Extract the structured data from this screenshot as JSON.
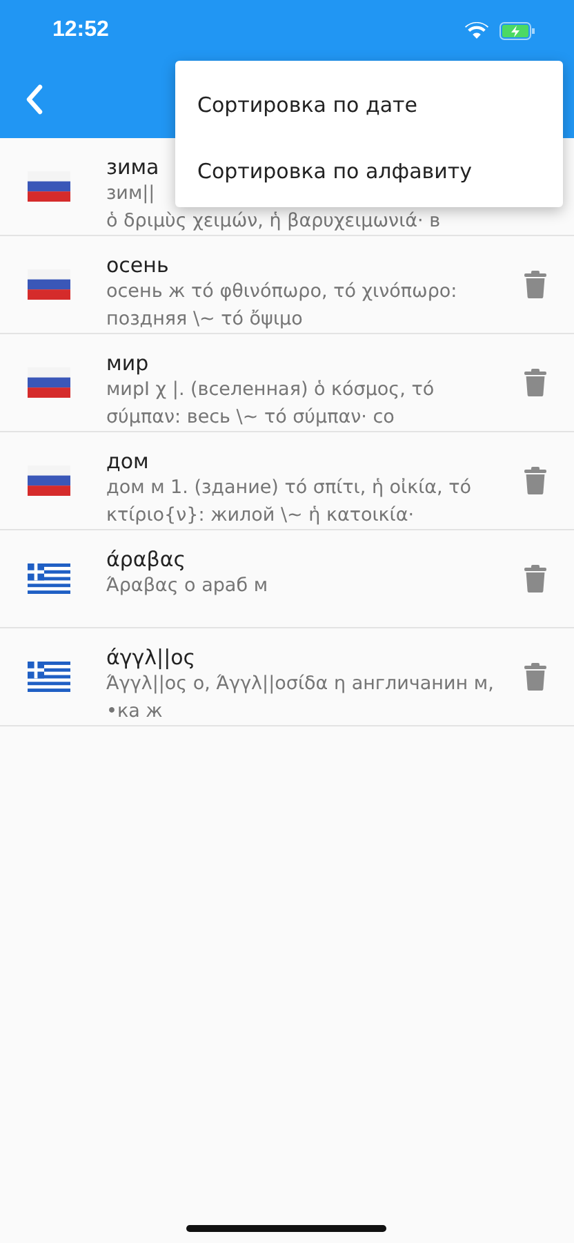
{
  "status_bar": {
    "time": "12:52"
  },
  "menu": {
    "items": [
      {
        "label": "Сортировка по дате"
      },
      {
        "label": "Сортировка по алфавиту"
      }
    ]
  },
  "entries": [
    {
      "kind": "ru",
      "word": "зима",
      "description": "зим||\nὁ δριμὺς χειμών, ἡ βαρυχειμωνιά· в",
      "has_delete": false
    },
    {
      "kind": "ru",
      "word": "осень",
      "description": " осень ж τό φθινόπωρο, τό χινόπωρο: поздняя \\~ τό ὄψιμο",
      "has_delete": true
    },
    {
      "kind": "ru",
      "word": "мир",
      "description": " мирI χ |. (вселенная) ὁ κόσμος, τό σύμπαν: весь \\~ τό σύμπαν· со",
      "has_delete": true
    },
    {
      "kind": "ru",
      "word": "дом",
      "description": " дом м 1. (здание) τό σπίτι, ἡ οἰκία, τό κτίριο{ν}: жилой \\~ ἡ κατοικία·",
      "has_delete": true
    },
    {
      "kind": "gr",
      "word": "άραβας",
      "description": " Άραβας ο араб м",
      "has_delete": true
    },
    {
      "kind": "gr",
      "word": "άγγλ||ος",
      "description": " Άγγλ||ος ο, Άγγλ||οσίδα η англичанин м, •ка ж",
      "has_delete": true
    }
  ]
}
